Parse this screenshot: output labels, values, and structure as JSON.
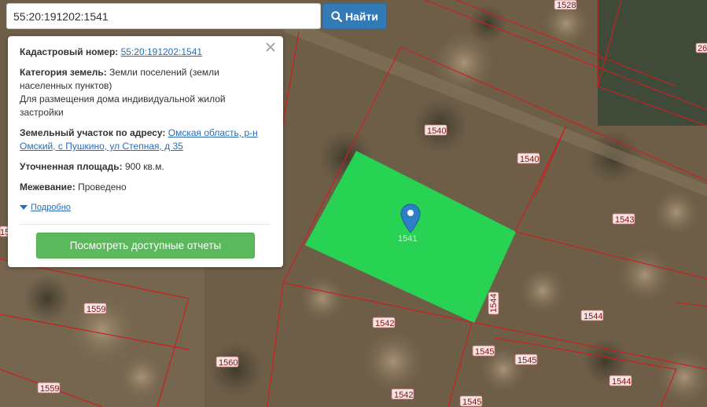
{
  "search": {
    "value": "55:20:191202:1541",
    "button_label": "Найти",
    "button_color": "#337ab7"
  },
  "info": {
    "cadastral_label": "Кадастровый номер:",
    "cadastral_value": "55:20:191202:1541",
    "category_label": "Категория земель:",
    "category_value": "Земли поселений (земли населенных пунктов)",
    "usage_value": "Для размещения дома индивидуальной жилой застройки",
    "address_label": "Земельный участок по адресу:",
    "address_value": "Омская область, р-н Омский, с Пушкино, ул Степная, д 35",
    "area_label": "Уточненная площадь:",
    "area_value": "900 кв.м.",
    "survey_label": "Межевание:",
    "survey_value": "Проведено",
    "details_label": "Подробно",
    "reports_button": "Посмотреть доступные отчеты",
    "reports_button_color": "#5cb85c",
    "link_color": "#2a6cb5"
  },
  "map": {
    "highlight_color": "#22dd55",
    "boundary_color": "#cc1f1f",
    "selected_label": "1541",
    "parcel_labels": [
      "1528",
      "26",
      "1540",
      "1540",
      "1543",
      "1544",
      "1542",
      "1544",
      "1545",
      "1545",
      "1559",
      "1560",
      "1559",
      "1542",
      "1545",
      "1544",
      "15"
    ]
  }
}
